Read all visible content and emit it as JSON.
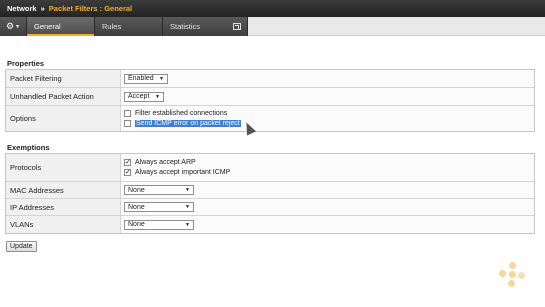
{
  "header": {
    "root": "Network",
    "separator": "»",
    "current": "Packet Filters : General"
  },
  "tabs": [
    {
      "label": "General",
      "active": true
    },
    {
      "label": "Rules",
      "active": false
    },
    {
      "label": "Statistics",
      "active": false
    }
  ],
  "icons": {
    "gear": "gear-icon",
    "external": "external-link-icon",
    "caret": "chevron-down-icon"
  },
  "properties": {
    "title": "Properties",
    "packet_filtering": {
      "label": "Packet Filtering",
      "value": "Enabled"
    },
    "unhandled": {
      "label": "Unhandled Packet Action",
      "value": "Accept"
    },
    "options": {
      "label": "Options",
      "filter_established": {
        "text": "Filter established connections",
        "checked": false
      },
      "send_icmp": {
        "text": "Send ICMP error on packet reject",
        "checked": false
      }
    }
  },
  "exemptions": {
    "title": "Exemptions",
    "protocols": {
      "label": "Protocols",
      "arp": {
        "text": "Always accept ARP",
        "checked": true
      },
      "icmp": {
        "text": "Always accept important ICMP",
        "checked": true
      }
    },
    "mac": {
      "label": "MAC Addresses",
      "value": "None"
    },
    "ip": {
      "label": "IP Addresses",
      "value": "None"
    },
    "vlans": {
      "label": "VLANs",
      "value": "None"
    }
  },
  "update_button": "Update",
  "colors": {
    "accent": "#f2b01e",
    "selection": "#3e7ed6",
    "header_bg": "#2e2e2e"
  }
}
